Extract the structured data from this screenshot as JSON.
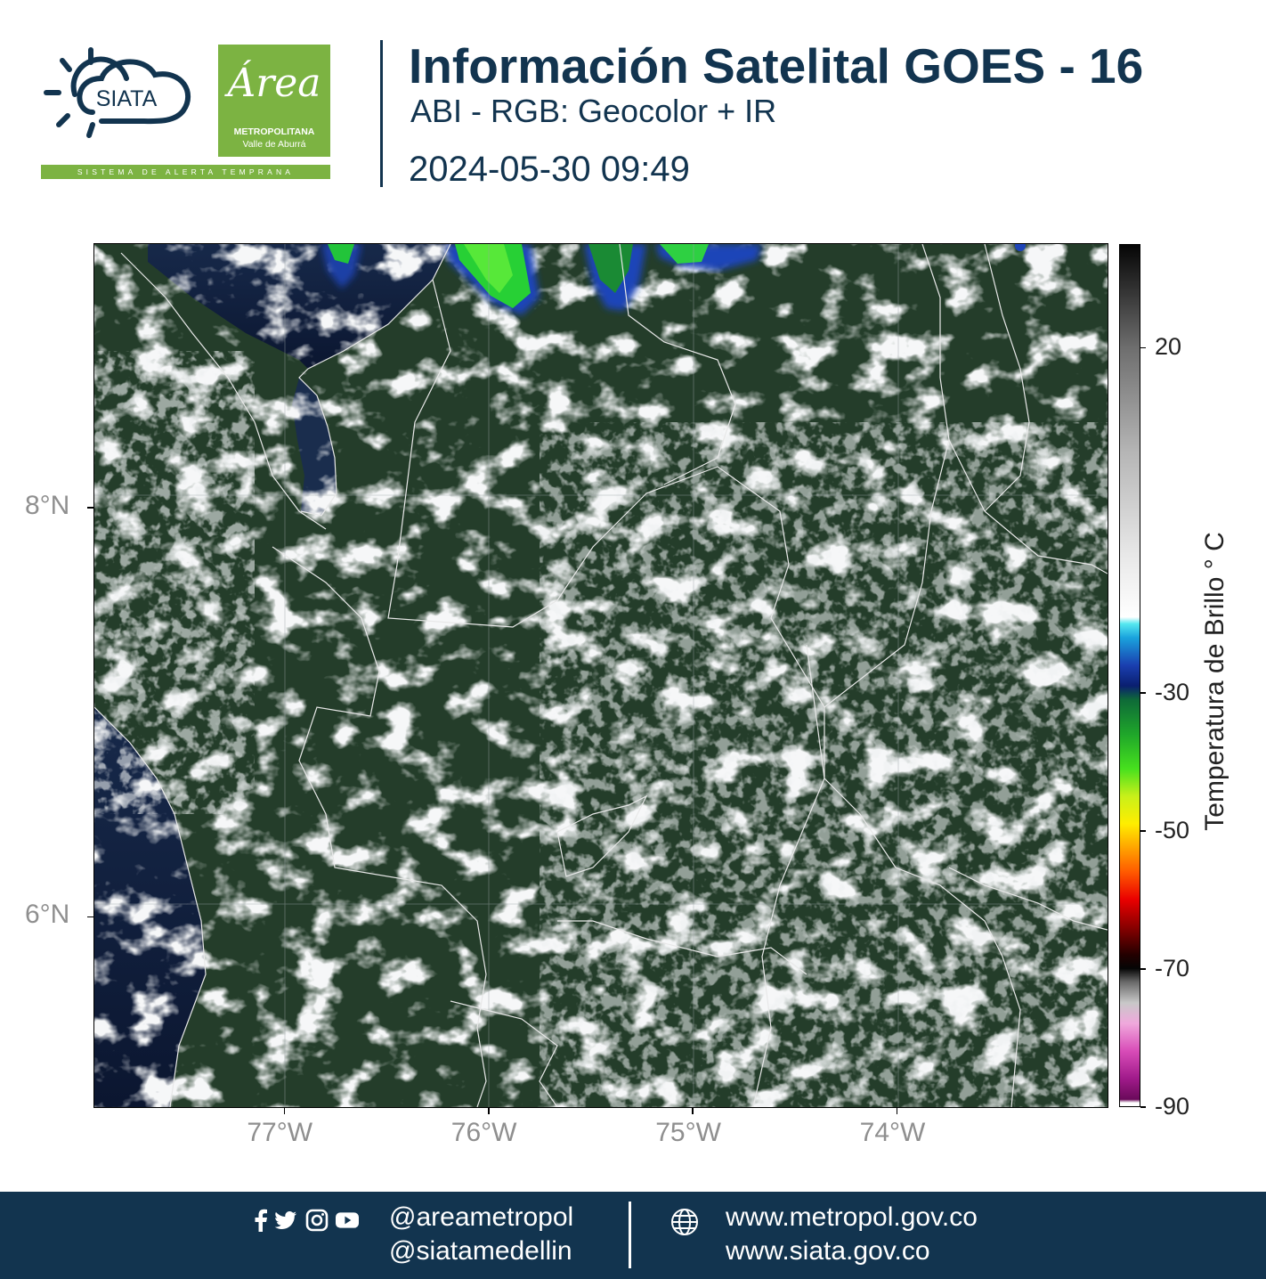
{
  "header": {
    "title": "Información Satelital GOES - 16",
    "subtitle": "ABI - RGB: Geocolor + IR",
    "timestamp": "2024-05-30 09:49"
  },
  "logos": {
    "siata_name": "SIATA",
    "siata_tagline": "SISTEMA DE ALERTA TEMPRANA",
    "area_script": "Área",
    "area_line1": "METROPOLITANA",
    "area_line2": "Valle de Aburrá"
  },
  "map": {
    "lat_ticks": [
      {
        "value": 8,
        "label": "8°N"
      },
      {
        "value": 6,
        "label": "6°N"
      }
    ],
    "lon_ticks": [
      {
        "value": -77,
        "label": "77°W"
      },
      {
        "value": -76,
        "label": "76°W"
      },
      {
        "value": -75,
        "label": "75°W"
      },
      {
        "value": -74,
        "label": "74°W"
      }
    ],
    "extent": {
      "lon_min": -77.93,
      "lon_max": -72.97,
      "lat_min": 5.07,
      "lat_max": 9.29
    },
    "colors": {
      "ocean": "#0d1a33",
      "land": "#203a26",
      "cloud": "#e6eaec",
      "border": "#e8e8e8"
    }
  },
  "colorbar": {
    "title": "Temperatura de Brillo  ° C",
    "range": [
      -90,
      35
    ],
    "tick_labels": [
      {
        "value": 20,
        "label": "20"
      },
      {
        "value": -30,
        "label": "-30"
      },
      {
        "value": -50,
        "label": "-50"
      },
      {
        "value": -70,
        "label": "-70"
      },
      {
        "value": -90,
        "label": "-90"
      }
    ]
  },
  "footer": {
    "handle1": "@areametropol",
    "handle2": "@siatamedellin",
    "url1": "www.metropol.gov.co",
    "url2": "www.siata.gov.co",
    "social_icons": [
      "facebook-icon",
      "twitter-icon",
      "instagram-icon",
      "youtube-icon"
    ]
  }
}
